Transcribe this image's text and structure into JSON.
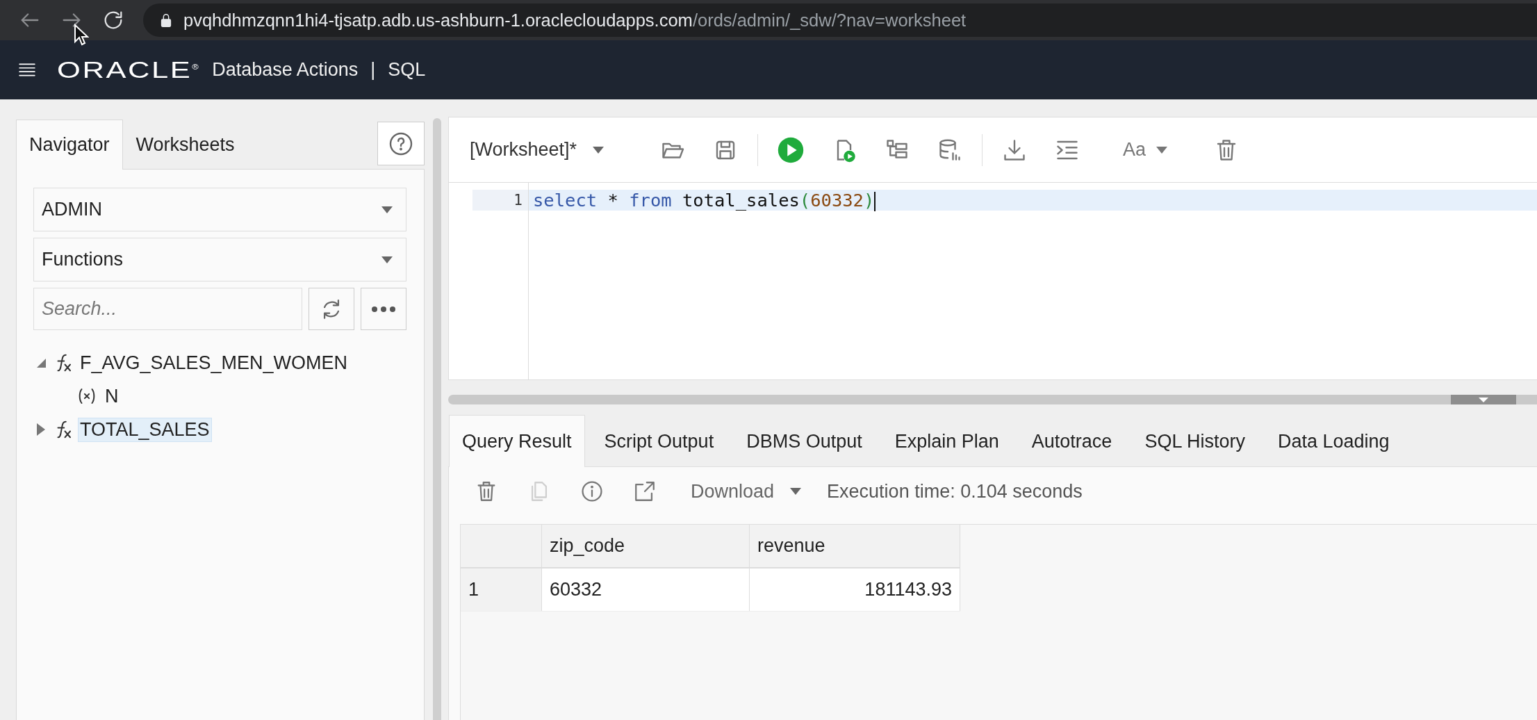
{
  "browser": {
    "url_host": "pvqhdhmzqnn1hi4-tjsatp.adb.us-ashburn-1.oraclecloudapps.com",
    "url_path": "/ords/admin/_sdw/?nav=worksheet"
  },
  "header": {
    "logo": "ORACLE",
    "trademark": "®",
    "app": "Database Actions",
    "separator": "|",
    "page": "SQL"
  },
  "navigator": {
    "tabs": [
      {
        "label": "Navigator",
        "selected": true
      },
      {
        "label": "Worksheets",
        "selected": false
      }
    ],
    "schema": "ADMIN",
    "object_type": "Functions",
    "search": {
      "placeholder": "Search..."
    },
    "tree": [
      {
        "kind": "function",
        "label": "F_AVG_SALES_MEN_WOMEN",
        "expanded": true,
        "selected": false,
        "children": [
          {
            "kind": "parameter",
            "label": "N",
            "selected": false
          }
        ]
      },
      {
        "kind": "function",
        "label": "TOTAL_SALES",
        "expanded": false,
        "selected": true
      }
    ]
  },
  "worksheet": {
    "name": "[Worksheet]*",
    "font_menu": "Aa",
    "lines": [
      {
        "number": "1",
        "tokens": [
          {
            "kind": "keyword",
            "text": "select"
          },
          {
            "kind": "plain",
            "text": " * "
          },
          {
            "kind": "keyword",
            "text": "from"
          },
          {
            "kind": "plain",
            "text": " total_sales"
          },
          {
            "kind": "paren",
            "text": "("
          },
          {
            "kind": "number",
            "text": "60332"
          },
          {
            "kind": "paren",
            "text": ")"
          }
        ]
      }
    ]
  },
  "results": {
    "tabs": [
      {
        "label": "Query Result",
        "selected": true
      },
      {
        "label": "Script Output",
        "selected": false
      },
      {
        "label": "DBMS Output",
        "selected": false
      },
      {
        "label": "Explain Plan",
        "selected": false
      },
      {
        "label": "Autotrace",
        "selected": false
      },
      {
        "label": "SQL History",
        "selected": false
      },
      {
        "label": "Data Loading",
        "selected": false
      }
    ],
    "tools": [
      {
        "kind": "delete",
        "disabled": false
      },
      {
        "kind": "copy",
        "disabled": true
      },
      {
        "kind": "info",
        "disabled": false
      },
      {
        "kind": "open",
        "disabled": false
      }
    ],
    "download": "Download",
    "execution_time": "Execution time: 0.104 seconds",
    "columns": [
      {
        "label": "zip_code",
        "numeric": false
      },
      {
        "label": "revenue",
        "numeric": true
      }
    ],
    "rows": [
      {
        "number": "1",
        "cells": [
          "60332",
          "181143.93"
        ]
      }
    ]
  }
}
